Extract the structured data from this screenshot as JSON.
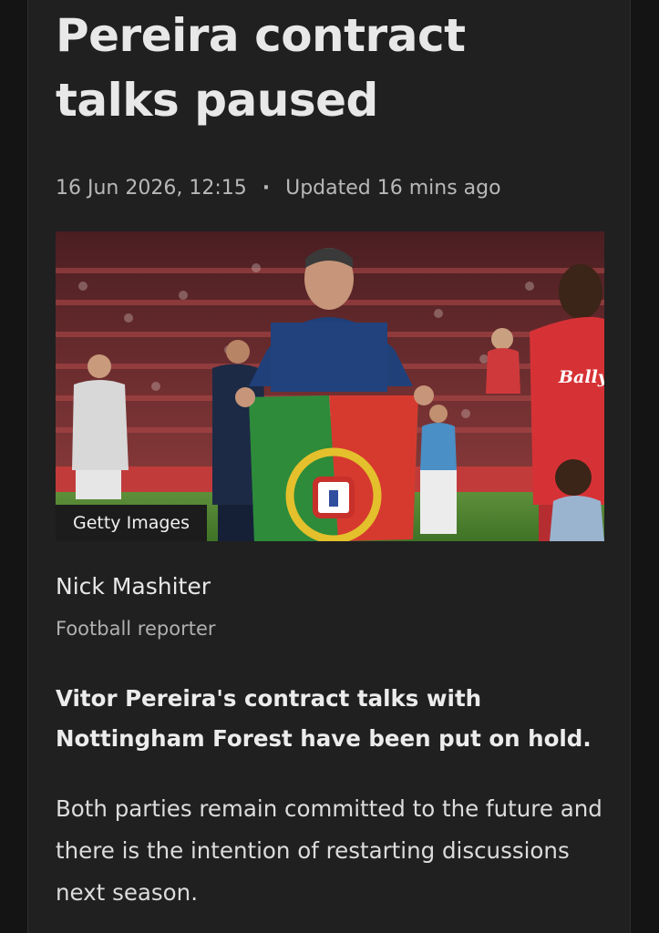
{
  "article": {
    "headline": "Pereira contract talks paused",
    "published": "16 Jun 2026, 12:15",
    "separator": "·",
    "updated": "Updated 16 mins ago",
    "image": {
      "caption": "Getty Images",
      "shirt_sponsor": "Bally's"
    },
    "author": {
      "name": "Nick Mashiter",
      "role": "Football reporter"
    },
    "lede": "Vitor Pereira's contract talks with Nottingham Forest have been put on hold.",
    "paragraph": "Both parties remain committed to the future and there is the intention of restarting discussions next season."
  },
  "colors": {
    "background": "#141414",
    "card": "#202020",
    "headline_text": "#e8e8e8",
    "meta_text": "#b8b8b8"
  }
}
